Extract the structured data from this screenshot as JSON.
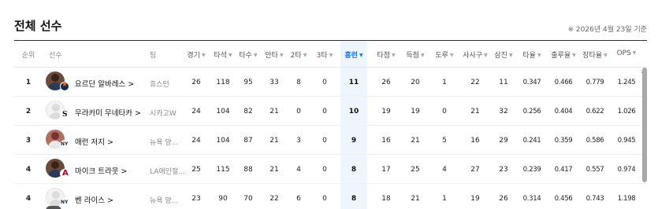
{
  "page": {
    "title": "전체 선수",
    "as_of": "※ 2026년 4월 23일 기준"
  },
  "columns": {
    "rank": "순위",
    "player": "선수",
    "team": "팀",
    "g": "경기",
    "pa": "타석",
    "ab": "타수",
    "h": "안타",
    "b2": "2타",
    "b3": "3타",
    "hr": "홈런",
    "rbi": "타점",
    "r": "득점",
    "sb": "도루",
    "bb": "사사구",
    "so": "삼진",
    "avg": "타율",
    "obp": "출루율",
    "slg": "장타율",
    "ops": "OPS"
  },
  "sort": {
    "column": "hr",
    "direction": "desc"
  },
  "players": [
    {
      "rank": "1",
      "name": "요르단 알바레스 >",
      "team": "휴스턴",
      "team_logo": "astros-logo-icon",
      "avatar": "photo",
      "g": "26",
      "pa": "118",
      "ab": "95",
      "h": "33",
      "b2": "8",
      "b3": "0",
      "hr": "11",
      "rbi": "26",
      "r": "20",
      "sb": "1",
      "bb": "22",
      "so": "11",
      "avg": "0.347",
      "obp": "0.466",
      "slg": "0.779",
      "ops": "1.245"
    },
    {
      "rank": "2",
      "name": "무라카미 무네타카 >",
      "team": "시카고W",
      "team_logo": "white-sox-logo-icon",
      "avatar": "ghost",
      "g": "24",
      "pa": "104",
      "ab": "82",
      "h": "21",
      "b2": "0",
      "b3": "0",
      "hr": "10",
      "rbi": "19",
      "r": "19",
      "sb": "0",
      "bb": "21",
      "so": "32",
      "avg": "0.256",
      "obp": "0.404",
      "slg": "0.622",
      "ops": "1.026"
    },
    {
      "rank": "3",
      "name": "애런 저지 >",
      "team": "뉴욕 양...",
      "team_logo": "yankees-logo-icon",
      "avatar": "photo2",
      "g": "24",
      "pa": "104",
      "ab": "87",
      "h": "21",
      "b2": "3",
      "b3": "0",
      "hr": "9",
      "rbi": "16",
      "r": "21",
      "sb": "5",
      "bb": "16",
      "so": "29",
      "avg": "0.241",
      "obp": "0.359",
      "slg": "0.586",
      "ops": "0.945"
    },
    {
      "rank": "4",
      "name": "마이크 트라웃 >",
      "team": "LA에인절...",
      "team_logo": "angels-logo-icon",
      "avatar": "photo",
      "g": "25",
      "pa": "115",
      "ab": "88",
      "h": "21",
      "b2": "4",
      "b3": "0",
      "hr": "8",
      "rbi": "17",
      "r": "25",
      "sb": "4",
      "bb": "27",
      "so": "23",
      "avg": "0.239",
      "obp": "0.417",
      "slg": "0.557",
      "ops": "0.974"
    },
    {
      "rank": "4",
      "name": "벤 라이스 >",
      "team": "뉴욕 양...",
      "team_logo": "yankees-logo-icon",
      "avatar": "ghost",
      "g": "23",
      "pa": "90",
      "ab": "70",
      "h": "22",
      "b2": "6",
      "b3": "0",
      "hr": "8",
      "rbi": "18",
      "r": "21",
      "sb": "1",
      "bb": "19",
      "so": "26",
      "avg": "0.314",
      "obp": "0.456",
      "slg": "0.743",
      "ops": "1.198"
    }
  ],
  "icons": {
    "sort_caret": "caret-down-icon",
    "scroll_up": "scroll-up-arrow-icon"
  },
  "colors": {
    "accent": "#1a73e8",
    "highlight_column": "#eef5fd"
  }
}
